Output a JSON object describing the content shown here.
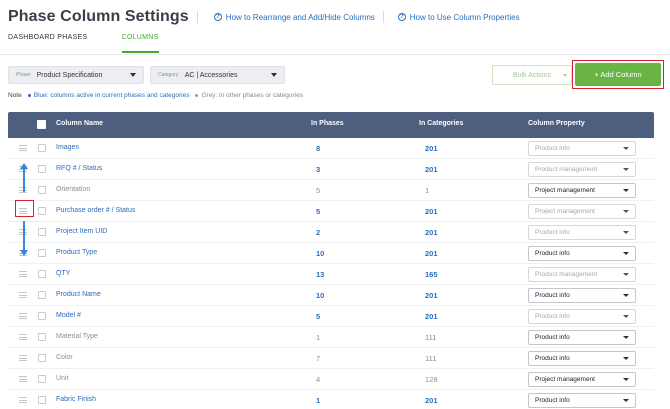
{
  "page_title": "Phase Column Settings",
  "help_links": [
    {
      "label": "How to Rearrange and Add/Hide Columns"
    },
    {
      "label": "How to Use Column Properties"
    }
  ],
  "tabs": [
    {
      "label": "DASHBOARD PHASES",
      "active": false
    },
    {
      "label": "COLUMNS",
      "active": true
    }
  ],
  "filters": {
    "phase": {
      "label": "Phase:",
      "value": "Product Specification"
    },
    "category": {
      "label": "Category:",
      "value": "AC | Accessories"
    }
  },
  "bulk_actions_label": "Bulk Actions",
  "add_column_label": "+ Add Column",
  "note": {
    "prefix": "Note",
    "blue": "Blue: columns active in current phases and categories",
    "grey": "Grey: in other phases or categories"
  },
  "colors": {
    "accent_green": "#6ab345",
    "active_blue": "#2a6ebd",
    "header_bg": "#4d5e7e",
    "highlight_red": "#d3262c"
  },
  "table": {
    "headers": [
      "Column Name",
      "In Phases",
      "In Categories",
      "Column Property"
    ],
    "rows": [
      {
        "name": "Images",
        "phases": "8",
        "categories": "201",
        "property": "Product info",
        "active": true,
        "property_editable": false
      },
      {
        "name": "RFQ # / Status",
        "phases": "3",
        "categories": "201",
        "property": "Product management",
        "active": true,
        "property_editable": false
      },
      {
        "name": "Orientation",
        "phases": "5",
        "categories": "1",
        "property": "Project management",
        "active": false,
        "property_editable": true
      },
      {
        "name": "Purchase order # / Status",
        "phases": "5",
        "categories": "201",
        "property": "Project management",
        "active": true,
        "property_editable": false
      },
      {
        "name": "Project Item UID",
        "phases": "2",
        "categories": "201",
        "property": "Product info",
        "active": true,
        "property_editable": false
      },
      {
        "name": "Product Type",
        "phases": "10",
        "categories": "201",
        "property": "Product info",
        "active": true,
        "property_editable": true
      },
      {
        "name": "QTY",
        "phases": "13",
        "categories": "165",
        "property": "Product management",
        "active": true,
        "property_editable": false
      },
      {
        "name": "Product Name",
        "phases": "10",
        "categories": "201",
        "property": "Product info",
        "active": true,
        "property_editable": true
      },
      {
        "name": "Model #",
        "phases": "5",
        "categories": "201",
        "property": "Product info",
        "active": true,
        "property_editable": false
      },
      {
        "name": "Material Type",
        "phases": "1",
        "categories": "111",
        "property": "Product info",
        "active": false,
        "property_editable": true
      },
      {
        "name": "Color",
        "phases": "7",
        "categories": "111",
        "property": "Product info",
        "active": false,
        "property_editable": true
      },
      {
        "name": "Unit",
        "phases": "4",
        "categories": "128",
        "property": "Project management",
        "active": false,
        "property_editable": true
      },
      {
        "name": "Fabric Finish",
        "phases": "1",
        "categories": "201",
        "property": "Product info",
        "active": true,
        "property_editable": true
      }
    ]
  }
}
